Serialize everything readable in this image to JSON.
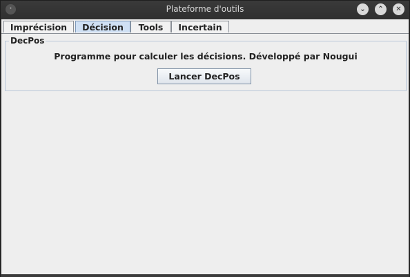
{
  "window": {
    "title": "Plateforme d'outils"
  },
  "tabs": [
    {
      "label": "Imprécision",
      "active": false
    },
    {
      "label": "Décision",
      "active": true
    },
    {
      "label": "Tools",
      "active": false
    },
    {
      "label": "Incertain",
      "active": false
    }
  ],
  "panel": {
    "legend": "DecPos",
    "description": "Programme pour calculer les décisions. Développé par Nougui",
    "button_label": "Lancer DecPos"
  },
  "colors": {
    "active_tab": "#cfe0f4",
    "titlebar": "#2f2f2f",
    "background": "#eeeeee"
  }
}
